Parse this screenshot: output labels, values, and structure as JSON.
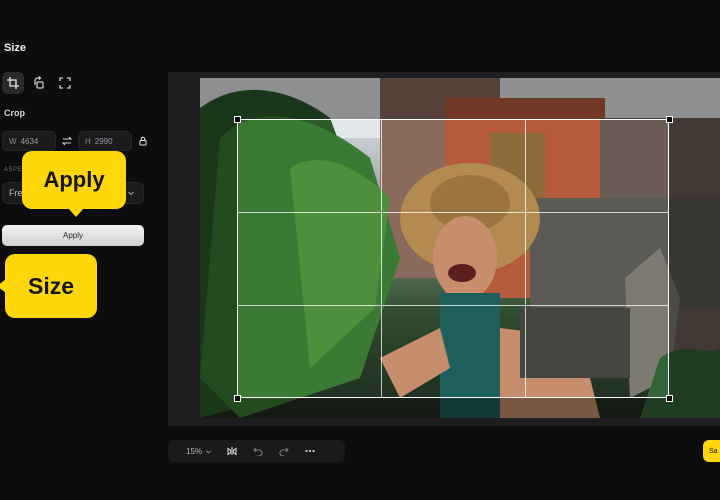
{
  "panel": {
    "title": "Size",
    "crop_label": "Crop",
    "width_prefix": "W",
    "width_value": "4634",
    "height_prefix": "H",
    "height_value": "2990",
    "ratio_label": "ASPECT RATIO",
    "ratio_value": "Fre",
    "apply_label": "Apply"
  },
  "tools": {
    "icons": [
      "crop-icon",
      "rotate-icon",
      "fullscreen-icon"
    ],
    "active": "crop-icon"
  },
  "callouts": {
    "apply": "Apply",
    "size": "Size"
  },
  "bottom_toolbar": {
    "zoom": "15%",
    "icons": [
      "chevron-down-icon",
      "flip-icon",
      "undo-icon",
      "redo-icon",
      "more-icon"
    ]
  },
  "save": {
    "label": "Sa"
  },
  "colors": {
    "accent": "#ffd60a",
    "background": "#0d0d0e",
    "canvas": "#1e1e20"
  }
}
